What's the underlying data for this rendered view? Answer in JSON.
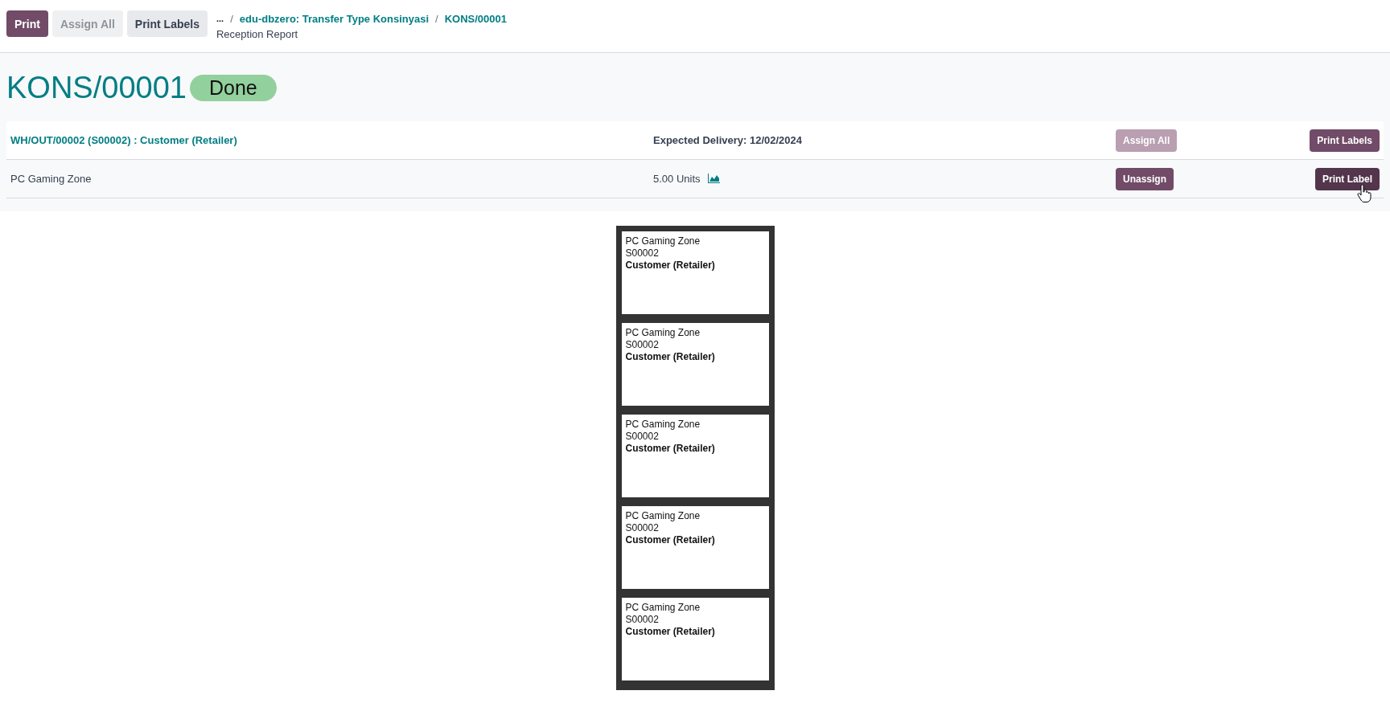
{
  "toolbar": {
    "buttons": [
      {
        "label": "Print",
        "kind": "primary",
        "disabled": false
      },
      {
        "label": "Assign All",
        "kind": "secondary",
        "disabled": true
      },
      {
        "label": "Print Labels",
        "kind": "secondary",
        "disabled": false
      }
    ]
  },
  "breadcrumb": {
    "ellipsis": "...",
    "separator": "/",
    "items": [
      "edu-dbzero: Transfer Type Konsinyasi",
      "KONS/00001"
    ],
    "current": "Reception Report"
  },
  "title": "KONS/00001",
  "status": "Done",
  "table": {
    "header": {
      "link": "WH/OUT/00002 (S00002) : Customer (Retailer)",
      "expected": "Expected Delivery: 12/02/2024",
      "assign": {
        "label": "Assign All",
        "disabled": true
      },
      "print": {
        "label": "Print Labels",
        "hovered": false
      }
    },
    "rows": [
      {
        "product": "PC Gaming Zone",
        "quantity": "5.00 Units",
        "action": {
          "label": "Unassign",
          "disabled": false
        },
        "print": {
          "label": "Print Label",
          "hovered": true
        }
      }
    ]
  },
  "labels": [
    {
      "product": "PC Gaming Zone",
      "order": "S00002",
      "partner": "Customer (Retailer)"
    },
    {
      "product": "PC Gaming Zone",
      "order": "S00002",
      "partner": "Customer (Retailer)"
    },
    {
      "product": "PC Gaming Zone",
      "order": "S00002",
      "partner": "Customer (Retailer)"
    },
    {
      "product": "PC Gaming Zone",
      "order": "S00002",
      "partner": "Customer (Retailer)"
    },
    {
      "product": "PC Gaming Zone",
      "order": "S00002",
      "partner": "Customer (Retailer)"
    }
  ]
}
